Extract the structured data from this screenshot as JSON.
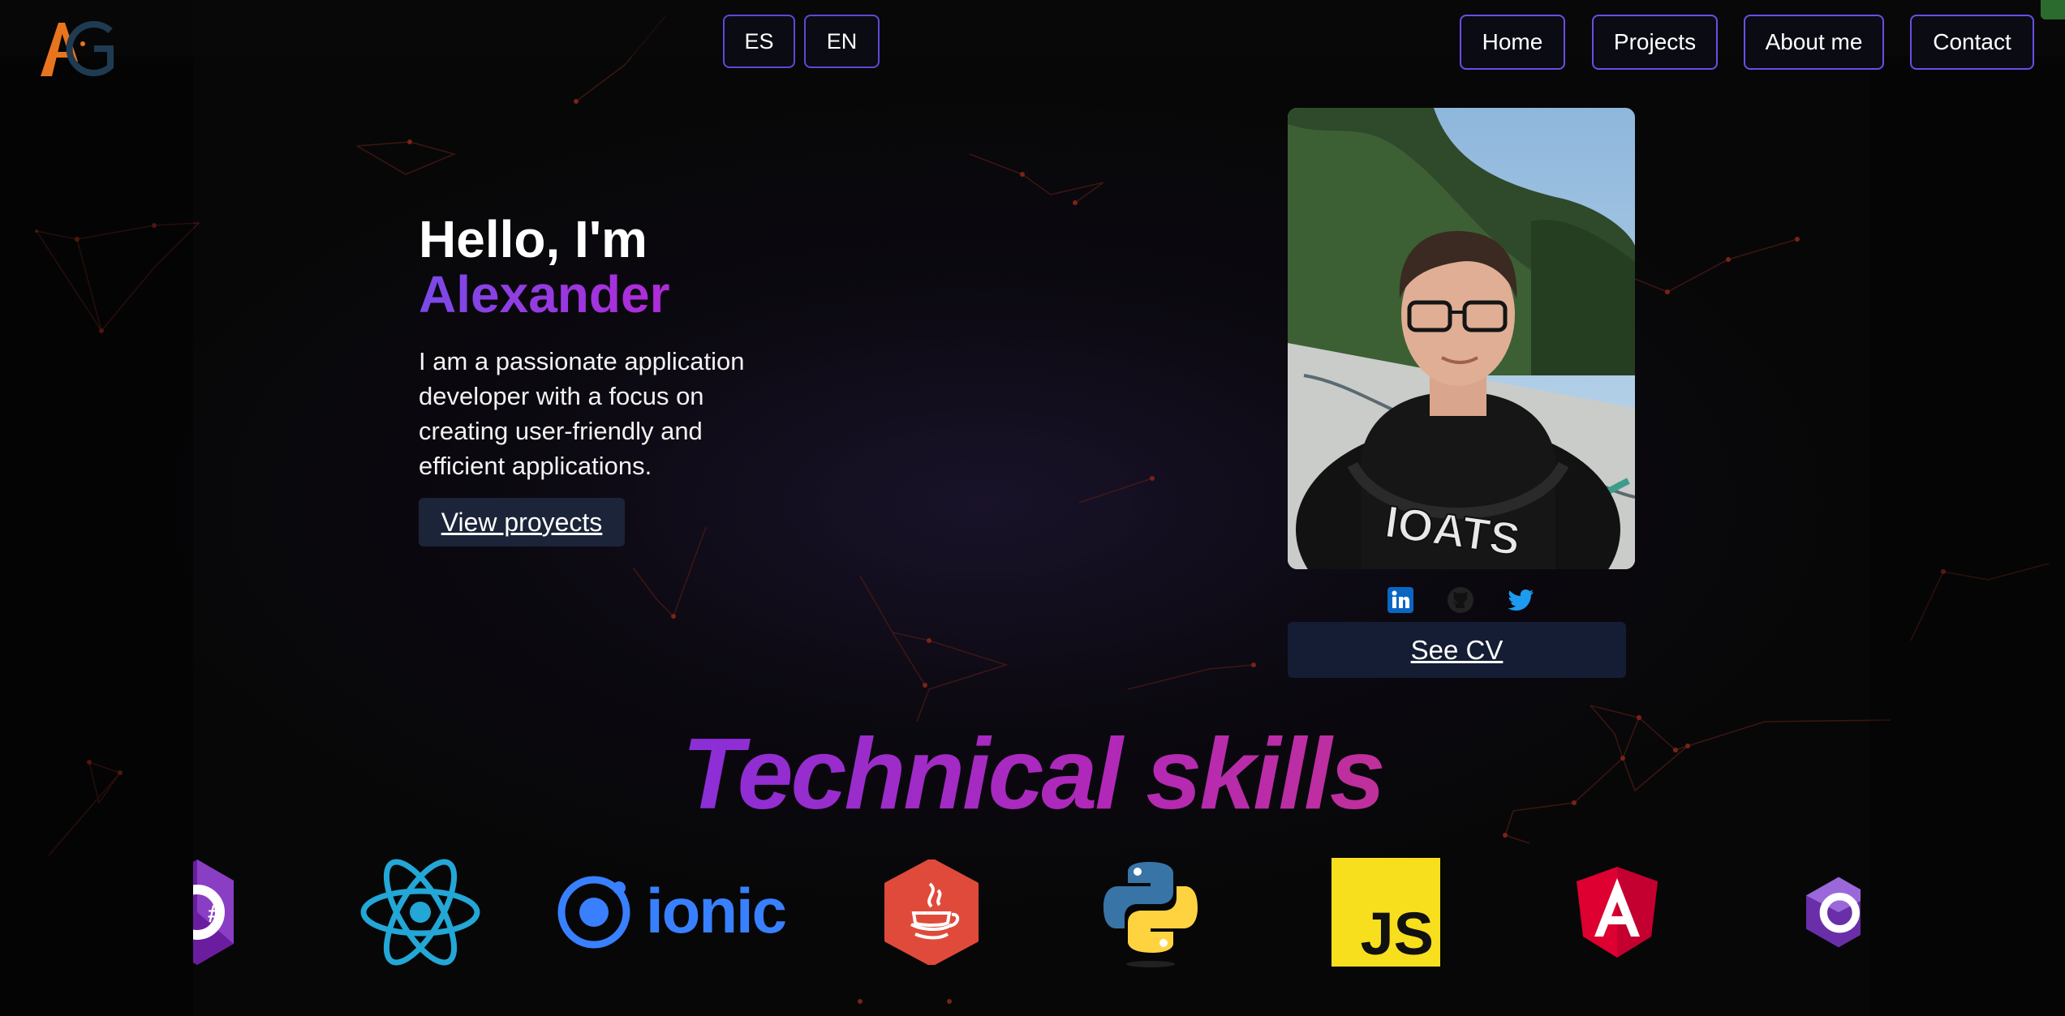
{
  "header": {
    "logo_icon": "ag-monogram-logo",
    "languages": [
      "ES",
      "EN"
    ],
    "nav": [
      "Home",
      "Projects",
      "About me",
      "Contact"
    ]
  },
  "hero": {
    "greeting": "Hello, I'm",
    "name": "Alexander",
    "description": "I am a passionate application developer with a focus on creating user-friendly and efficient applications.",
    "cta_label": "View proyects"
  },
  "profile": {
    "photo_icon": "profile-photo",
    "socials": [
      "linkedin-icon",
      "github-icon",
      "twitter-icon"
    ],
    "cv_label": "See CV"
  },
  "skills": {
    "title": "Technical skills",
    "logos": [
      "csharp-icon",
      "react-icon",
      "ionic-icon",
      "java-icon",
      "python-icon",
      "javascript-icon",
      "angular-icon",
      "dotnet-icon"
    ],
    "ionic_text": "ionic",
    "js_text": "JS"
  },
  "colors": {
    "accent_purple": "#7a4ae8",
    "accent_magenta": "#b22ad8",
    "button_bg": "#1b2438",
    "nav_border": "#6a4ee6"
  }
}
